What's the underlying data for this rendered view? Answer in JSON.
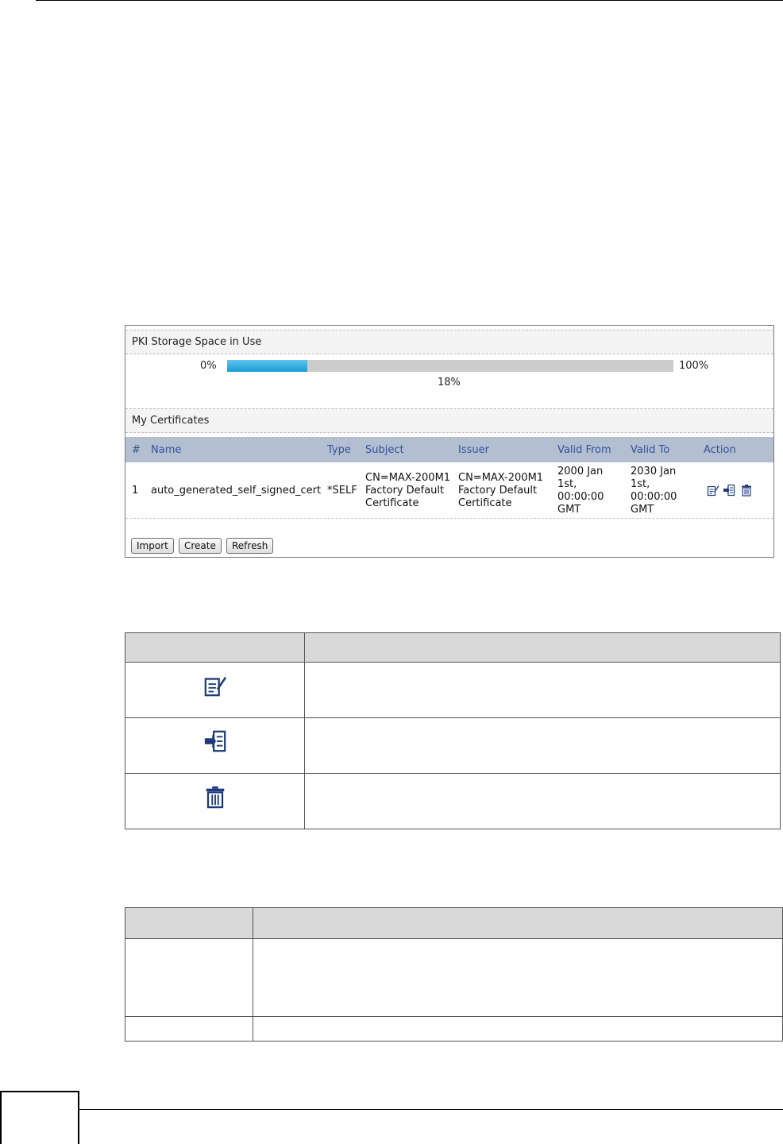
{
  "storage": {
    "section_title": "PKI Storage Space in Use",
    "min_label": "0%",
    "max_label": "100%",
    "used_label": "18%",
    "used_fraction": 0.18
  },
  "certificates": {
    "section_title": "My Certificates",
    "columns": [
      "#",
      "Name",
      "Type",
      "Subject",
      "Issuer",
      "Valid From",
      "Valid To",
      "Action"
    ],
    "rows": [
      {
        "index": "1",
        "name": "auto_generated_self_signed_cert",
        "type": "*SELF",
        "subject": [
          "CN=MAX-200M1",
          "Factory Default",
          "Certificate"
        ],
        "issuer": [
          "CN=MAX-200M1",
          "Factory Default",
          "Certificate"
        ],
        "valid_from": [
          "2000 Jan",
          "1st,",
          "00:00:00",
          "GMT"
        ],
        "valid_to": [
          "2030 Jan",
          "1st,",
          "00:00:00",
          "GMT"
        ],
        "actions": [
          "edit-icon",
          "export-icon",
          "delete-icon"
        ]
      }
    ]
  },
  "buttons": {
    "import": "Import",
    "create": "Create",
    "refresh": "Refresh"
  },
  "icon_table": {
    "icons": [
      "edit-icon",
      "export-icon",
      "delete-icon"
    ]
  },
  "colors": {
    "header_bg": "#b3bfd1",
    "header_text": "#31529b",
    "progress_fill": "#1a9ad6",
    "progress_track": "#cccccc",
    "table_header_bg": "#d9d9d9"
  }
}
